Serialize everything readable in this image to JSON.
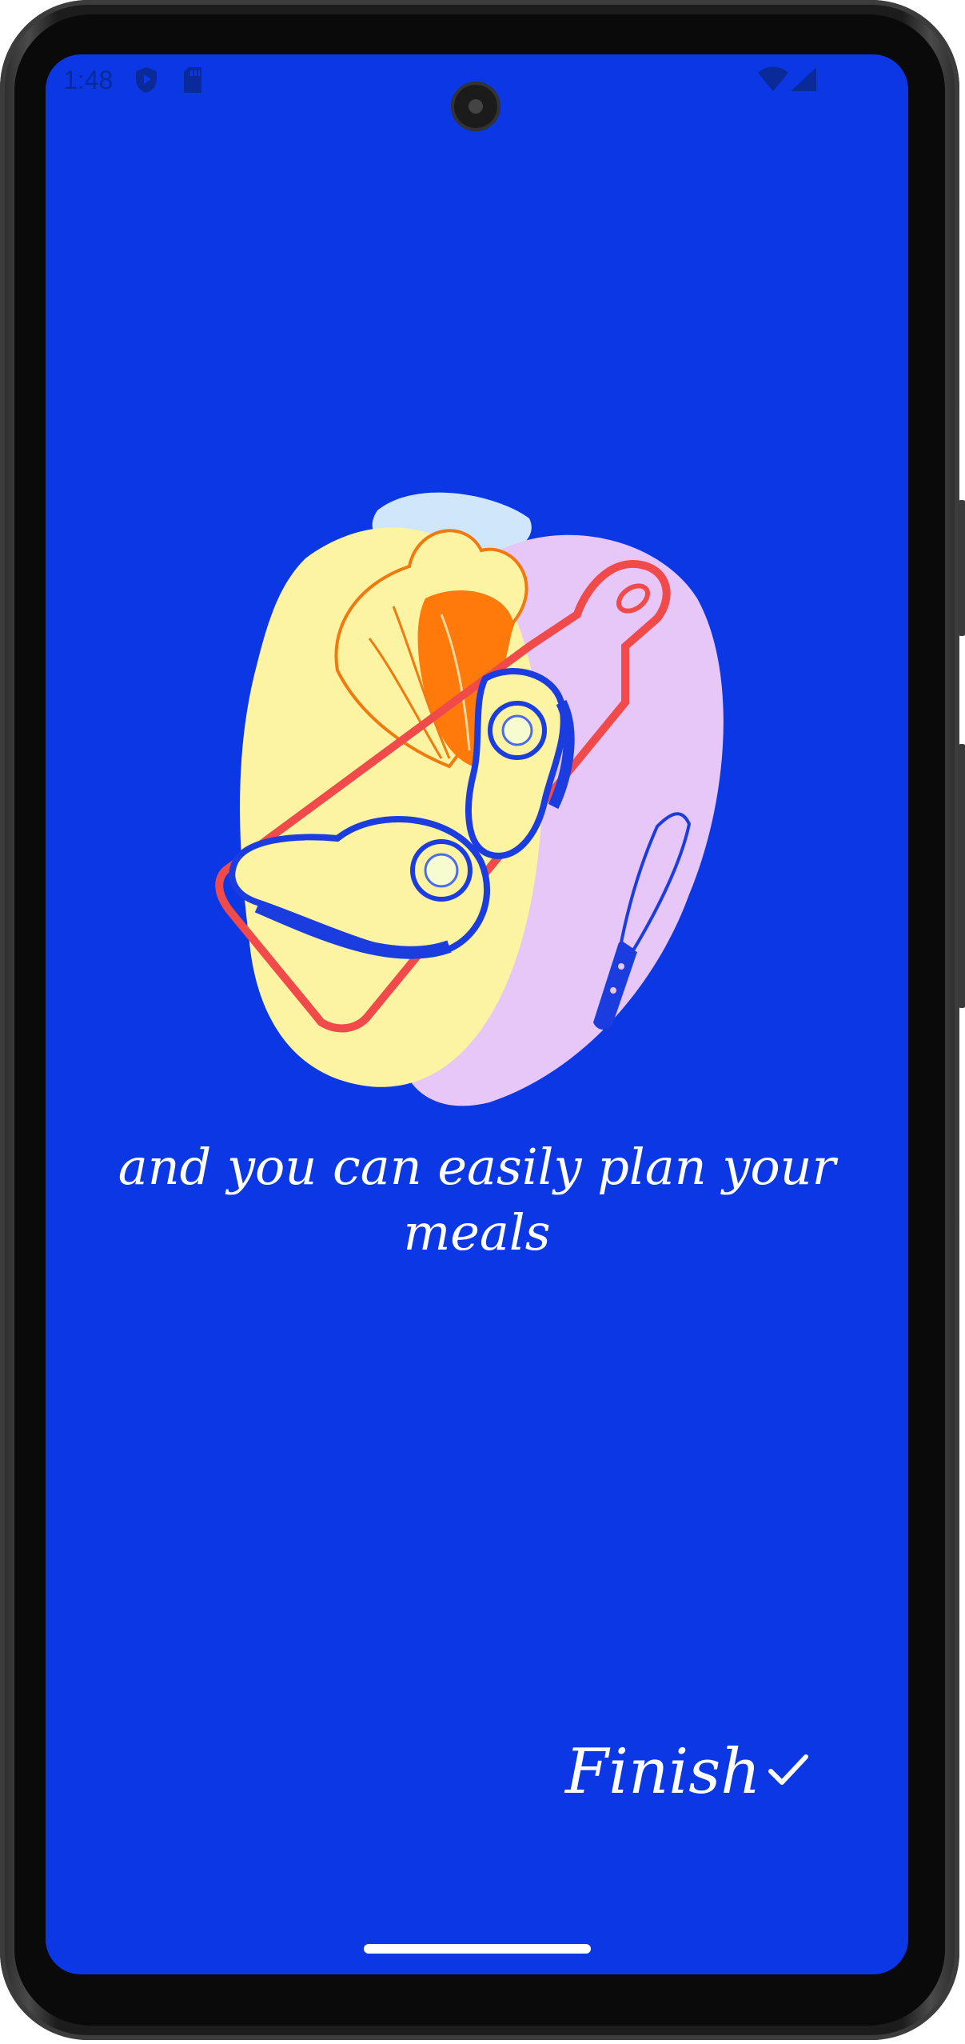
{
  "status_bar": {
    "time": "1:48",
    "icons": [
      "shield-play-icon",
      "sd-card-icon",
      "wifi-icon",
      "cell-signal-icon"
    ]
  },
  "onboarding": {
    "illustration": "cutting-board-avocado-knife-illustration",
    "caption": "and you can easily plan your meals",
    "finish_label": "Finish",
    "finish_icon": "check-icon"
  },
  "colors": {
    "background": "#0b37e4",
    "text": "#ffffff"
  }
}
